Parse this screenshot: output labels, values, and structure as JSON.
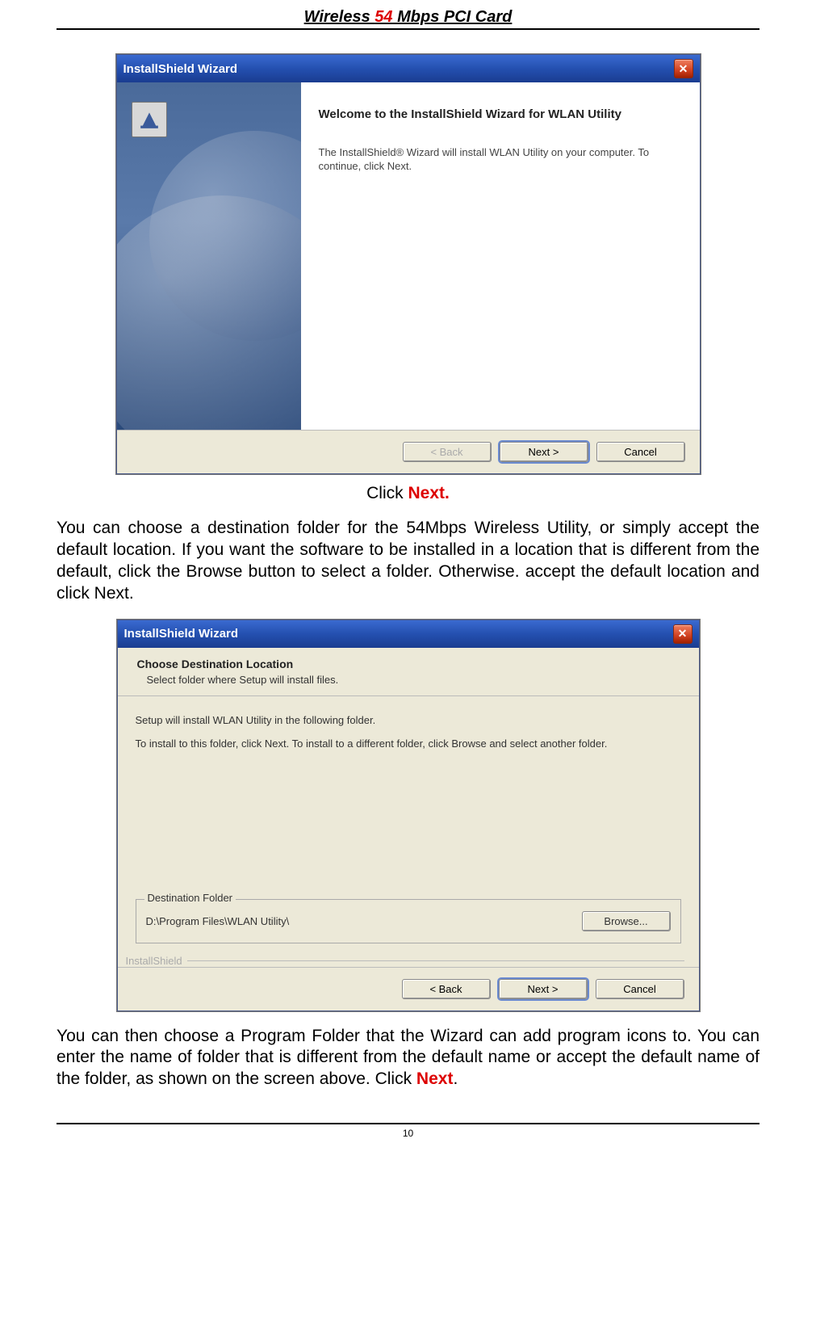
{
  "header": {
    "pre": "Wireless ",
    "mid": "54",
    "post": " Mbps PCI Card"
  },
  "ss1": {
    "title": "InstallShield Wizard",
    "welcome_heading": "Welcome to the InstallShield Wizard for WLAN Utility",
    "welcome_body": "The InstallShield® Wizard will install WLAN Utility on your computer.  To continue, click Next.",
    "btn_back": "< Back",
    "btn_next": "Next >",
    "btn_cancel": "Cancel"
  },
  "caption1_pre": "Click ",
  "caption1_bold": "Next.",
  "para1": "You can choose a destination folder for the 54Mbps Wireless Utility, or simply accept the default location.  If you want the software to be installed in a location that is different from the default, click the Browse button to select a folder.  Otherwise. accept the default location and click Next.",
  "ss2": {
    "title": "InstallShield Wizard",
    "panel_title": "Choose Destination Location",
    "panel_sub": "Select folder where Setup will install files.",
    "line1": "Setup will install WLAN Utility in the following folder.",
    "line2": "To install to this folder, click Next. To install to a different folder, click Browse and select another folder.",
    "dest_legend": "Destination Folder",
    "dest_path": "D:\\Program Files\\WLAN Utility\\",
    "browse": "Browse...",
    "brand": "InstallShield",
    "btn_back": "< Back",
    "btn_next": "Next >",
    "btn_cancel": "Cancel"
  },
  "para2_pre": "You can then choose a Program Folder that the Wizard can add program icons to. You can enter the name of folder that is different from the default name or accept the default name of the folder, as shown on the screen above. Click ",
  "para2_bold": "Next",
  "para2_post": ".",
  "page_number": "10"
}
